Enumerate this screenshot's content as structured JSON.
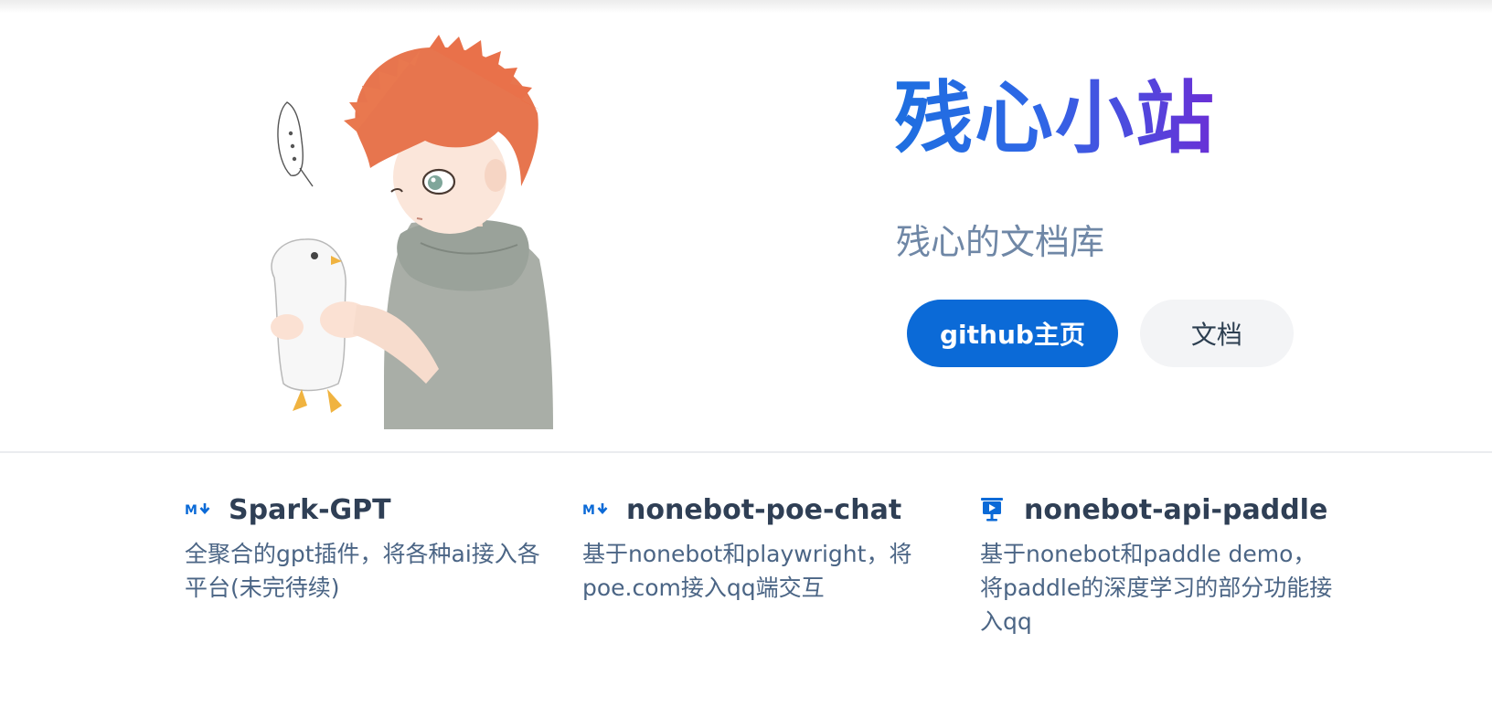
{
  "hero": {
    "image": {
      "name": "anime-boy-holding-penguin-illustration"
    },
    "title": "残心小站",
    "tagline": "残心的文档库",
    "actions": [
      {
        "label": "github主页",
        "style": "primary"
      },
      {
        "label": "文档",
        "style": "secondary"
      }
    ]
  },
  "features": [
    {
      "icon": "markdown-icon",
      "title": "Spark-GPT",
      "description": "全聚合的gpt插件，将各种ai接入各平台(未完待续)"
    },
    {
      "icon": "markdown-icon",
      "title": "nonebot-poe-chat",
      "description": "基于nonebot和playwright，将poe.com接入qq端交互"
    },
    {
      "icon": "presentation-icon",
      "title": "nonebot-api-paddle",
      "description": "基于nonebot和paddle demo，将paddle的深度学习的部分功能接入qq"
    }
  ],
  "colors": {
    "primary": "#0b6ad7",
    "title_gradient_start": "#1e6fe0",
    "title_gradient_end": "#6a2fd6",
    "tagline": "#6f87a6",
    "feature_title": "#2f3f55",
    "feature_desc": "#4b6585"
  }
}
